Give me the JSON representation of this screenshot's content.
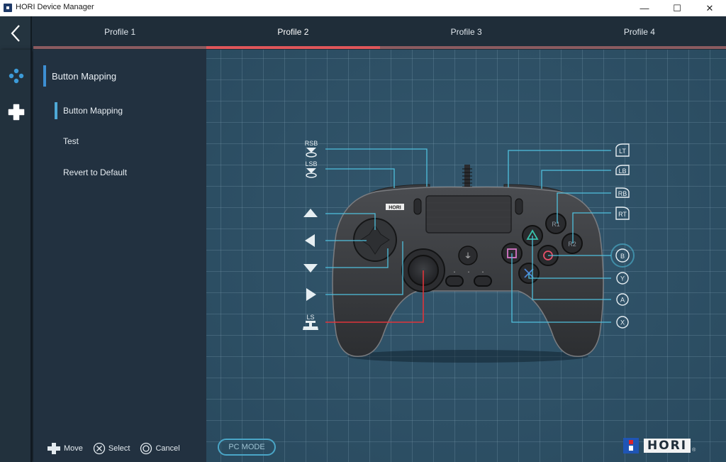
{
  "window": {
    "title": "HORI Device Manager",
    "controls": {
      "minimize": "—",
      "maximize": "☐",
      "close": "✕"
    }
  },
  "header": {
    "back_icon": "chevron-left-icon",
    "tabs": [
      {
        "label": "Profile 1",
        "active": false
      },
      {
        "label": "Profile 2",
        "active": true
      },
      {
        "label": "Profile 3",
        "active": false
      },
      {
        "label": "Profile 4",
        "active": false
      }
    ]
  },
  "rail": {
    "items": [
      {
        "icon": "buttons-icon",
        "active": true
      },
      {
        "icon": "dpad-icon",
        "active": false
      }
    ]
  },
  "sidemenu": {
    "heading": "Button Mapping",
    "items": [
      {
        "label": "Button Mapping",
        "selected": true
      },
      {
        "label": "Test",
        "selected": false
      },
      {
        "label": "Revert to Default",
        "selected": false
      }
    ]
  },
  "footer": {
    "hints": [
      {
        "icon": "dpad-icon",
        "label": "Move"
      },
      {
        "icon": "cross-button-icon",
        "label": "Select"
      },
      {
        "icon": "circle-button-icon",
        "label": "Cancel"
      }
    ]
  },
  "mapping": {
    "left_labels": [
      {
        "id": "rsb",
        "label": "RSB",
        "target": "left-shoulder-rear"
      },
      {
        "id": "lsb",
        "label": "LSB",
        "target": "left-shoulder-front"
      },
      {
        "id": "up",
        "label": "▲",
        "target": "dpad-up"
      },
      {
        "id": "left",
        "label": "◀",
        "target": "dpad-left"
      },
      {
        "id": "down",
        "label": "▼",
        "target": "dpad-down"
      },
      {
        "id": "right",
        "label": "▶",
        "target": "dpad-right"
      },
      {
        "id": "ls",
        "label": "LS",
        "target": "left-stick"
      }
    ],
    "right_labels": [
      {
        "id": "lt",
        "label": "LT",
        "target": "right-shoulder-rear"
      },
      {
        "id": "lb",
        "label": "LB",
        "target": "right-shoulder-front"
      },
      {
        "id": "rb",
        "label": "RB",
        "target": "R1"
      },
      {
        "id": "rt",
        "label": "RT",
        "target": "R2"
      },
      {
        "id": "b",
        "label": "B",
        "target": "circle",
        "highlighted": true
      },
      {
        "id": "y",
        "label": "Y",
        "target": "cross"
      },
      {
        "id": "a",
        "label": "A",
        "target": "triangle"
      },
      {
        "id": "x",
        "label": "X",
        "target": "square"
      }
    ],
    "controller_buttons": {
      "r1": "R1",
      "r2": "R2",
      "brand": "HORI"
    },
    "highlight_line_color": "#e0343a",
    "line_color": "#4fc0dd"
  },
  "canvas": {
    "pc_mode_label": "PC MODE",
    "logo_text": "HORI",
    "logo_reg": "®"
  },
  "colors": {
    "accent_red": "#e0565a",
    "accent_blue": "#3d8fd3",
    "canvas_bg": "#2f5166",
    "panel_bg": "#223140"
  }
}
